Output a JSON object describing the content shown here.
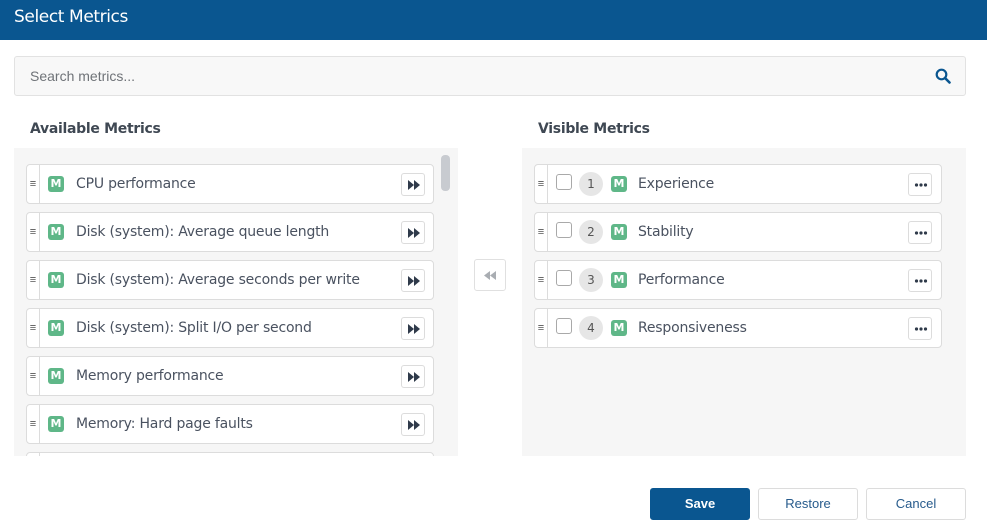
{
  "header": {
    "title": "Select Metrics"
  },
  "search": {
    "placeholder": "Search metrics...",
    "value": "",
    "icon": "search-icon"
  },
  "available": {
    "title": "Available Metrics",
    "items": [
      {
        "badge": "M",
        "label": "CPU performance",
        "action_icon": "fast-forward-icon"
      },
      {
        "badge": "M",
        "label": "Disk (system): Average queue length",
        "action_icon": "fast-forward-icon"
      },
      {
        "badge": "M",
        "label": "Disk (system): Average seconds per write",
        "action_icon": "fast-forward-icon"
      },
      {
        "badge": "M",
        "label": "Disk (system): Split I/O per second",
        "action_icon": "fast-forward-icon"
      },
      {
        "badge": "M",
        "label": "Memory performance",
        "action_icon": "fast-forward-icon"
      },
      {
        "badge": "M",
        "label": "Memory: Hard page faults",
        "action_icon": "fast-forward-icon"
      },
      {
        "badge": "",
        "label": "",
        "action_icon": ""
      }
    ]
  },
  "move_all_back": {
    "icon": "rewind-icon"
  },
  "visible": {
    "title": "Visible Metrics",
    "items": [
      {
        "order": "1",
        "badge": "M",
        "label": "Experience",
        "checked": false,
        "menu_icon": "more-icon"
      },
      {
        "order": "2",
        "badge": "M",
        "label": "Stability",
        "checked": false,
        "menu_icon": "more-icon"
      },
      {
        "order": "3",
        "badge": "M",
        "label": "Performance",
        "checked": false,
        "menu_icon": "more-icon"
      },
      {
        "order": "4",
        "badge": "M",
        "label": "Responsiveness",
        "checked": false,
        "menu_icon": "more-icon"
      }
    ]
  },
  "footer": {
    "save": "Save",
    "restore": "Restore",
    "cancel": "Cancel"
  },
  "colors": {
    "primary": "#0a5690",
    "metric_badge": "#5fb788"
  }
}
